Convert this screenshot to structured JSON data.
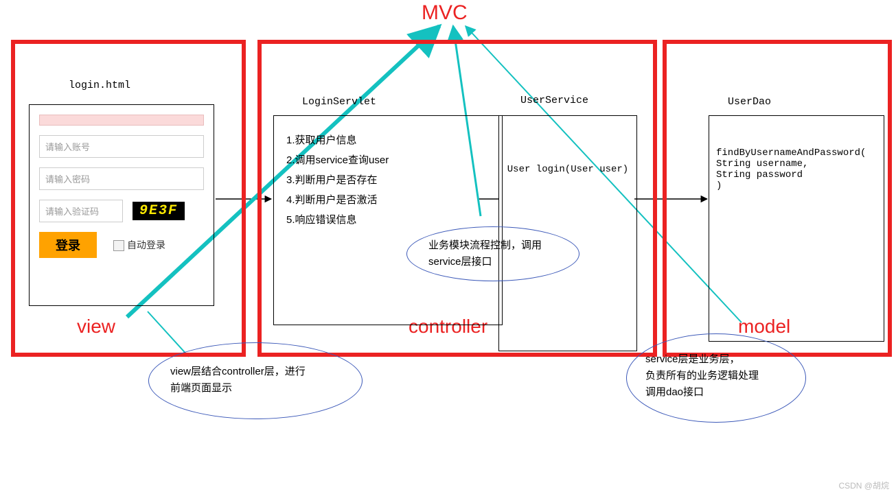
{
  "title": "MVC",
  "labels": {
    "view": "view",
    "controller": "controller",
    "model": "model"
  },
  "login": {
    "file": "login.html",
    "account_ph": "请输入账号",
    "password_ph": "请输入密码",
    "captcha_ph": "请输入验证码",
    "captcha_code": "9E3F",
    "submit": "登录",
    "auto": "自动登录"
  },
  "servlet": {
    "name": "LoginServlet",
    "steps": [
      "1.获取用户信息",
      "2.调用service查询user",
      "3.判断用户是否存在",
      "4.判断用户是否激活",
      "5.响应错误信息"
    ]
  },
  "service": {
    "name": "UserService",
    "method": "User login(User user)"
  },
  "dao": {
    "name": "UserDao",
    "method": "findByUsernameAndPassword(\nString username,\nString password\n)"
  },
  "notes": {
    "view": "view层结合controller层，进行\n前端页面显示",
    "ctrl": "业务模块流程控制，调用\nservice层接口",
    "svc": "service层是业务层，\n负责所有的业务逻辑处理\n调用dao接口"
  },
  "watermark": "CSDN @胡烷",
  "colors": {
    "frame": "#eb2222",
    "teal": "#14c1c0",
    "accent": "#ffa200"
  }
}
